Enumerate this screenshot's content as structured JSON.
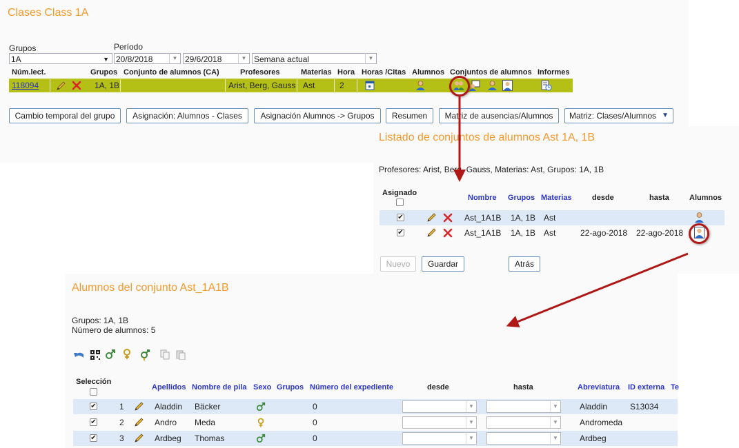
{
  "main": {
    "title": "Clases Class 1A",
    "grupos_label": "Grupos",
    "grupos_value": "1A",
    "periodo_label": "Período",
    "fecha_desde": "20/8/2018",
    "fecha_hasta": "29/6/2018",
    "semana": "Semana actual",
    "columns": {
      "num_lect": "Núm.lect.",
      "grupos": "Grupos",
      "conjunto": "Conjunto de alumnos (CA)",
      "profesores": "Profesores",
      "materias": "Materias",
      "hora": "Hora",
      "horas_citas": "Horas /Citas",
      "alumnos": "Alumnos",
      "conjuntos": "Conjuntos de alumnos",
      "informes": "Informes"
    },
    "row": {
      "num": "118094",
      "grupos": "1A, 1B",
      "conjunto": "",
      "profesores": "Arist, Berg, Gauss",
      "materias": "Ast",
      "hora": "2"
    },
    "buttons": [
      "Cambio temporal del grupo",
      "Asignación: Alumnos - Clases",
      "Asignación Alumnos -> Grupos",
      "Resumen",
      "Matriz de ausencias/Alumnos",
      "Matriz: Clases/Alumnos"
    ]
  },
  "listado": {
    "title": "Listado de conjuntos de alumnos Ast 1A, 1B",
    "info": "Profesores: Arist, Berg, Gauss, Materias: Ast, Grupos: 1A, 1B",
    "columns": {
      "asignado": "Asignado",
      "nombre": "Nombre",
      "grupos": "Grupos",
      "materias": "Materias",
      "desde": "desde",
      "hasta": "hasta",
      "alumnos": "Alumnos"
    },
    "rows": [
      {
        "nombre": "Ast_1A1B",
        "grupos": "1A, 1B",
        "materias": "Ast",
        "desde": "",
        "hasta": ""
      },
      {
        "nombre": "Ast_1A1B",
        "grupos": "1A, 1B",
        "materias": "Ast",
        "desde": "22-ago-2018",
        "hasta": "22-ago-2018"
      }
    ],
    "buttons": {
      "nuevo": "Nuevo",
      "guardar": "Guardar",
      "atras": "Atrás"
    }
  },
  "alumnos": {
    "title": "Alumnos del conjunto Ast_1A1B",
    "grupos_info": "Grupos: 1A, 1B",
    "numero_info": "Número de alumnos: 5",
    "columns": {
      "seleccion": "Selección",
      "apellidos": "Apellidos",
      "nombre": "Nombre de pila",
      "sexo": "Sexo",
      "grupos": "Grupos",
      "expediente": "Número del expediente",
      "desde": "desde",
      "hasta": "hasta",
      "abreviatura": "Abreviatura",
      "id_externa": "ID externa",
      "te": "Te"
    },
    "rows": [
      {
        "n": "1",
        "apellidos": "Aladdin",
        "nombre": "Bäcker",
        "sexo": "male",
        "expediente": "0",
        "abreviatura": "Aladdin",
        "id": "S13034"
      },
      {
        "n": "2",
        "apellidos": "Andro",
        "nombre": "Meda",
        "sexo": "female",
        "expediente": "0",
        "abreviatura": "Andromeda",
        "id": ""
      },
      {
        "n": "3",
        "apellidos": "Ardbeg",
        "nombre": "Thomas",
        "sexo": "male",
        "expediente": "0",
        "abreviatura": "Ardbeg",
        "id": ""
      }
    ]
  },
  "colors": {
    "accent": "#f39a2e",
    "green_row": "#b5c017",
    "link_blue": "#2a35c8",
    "arrow_red": "#b01818"
  }
}
